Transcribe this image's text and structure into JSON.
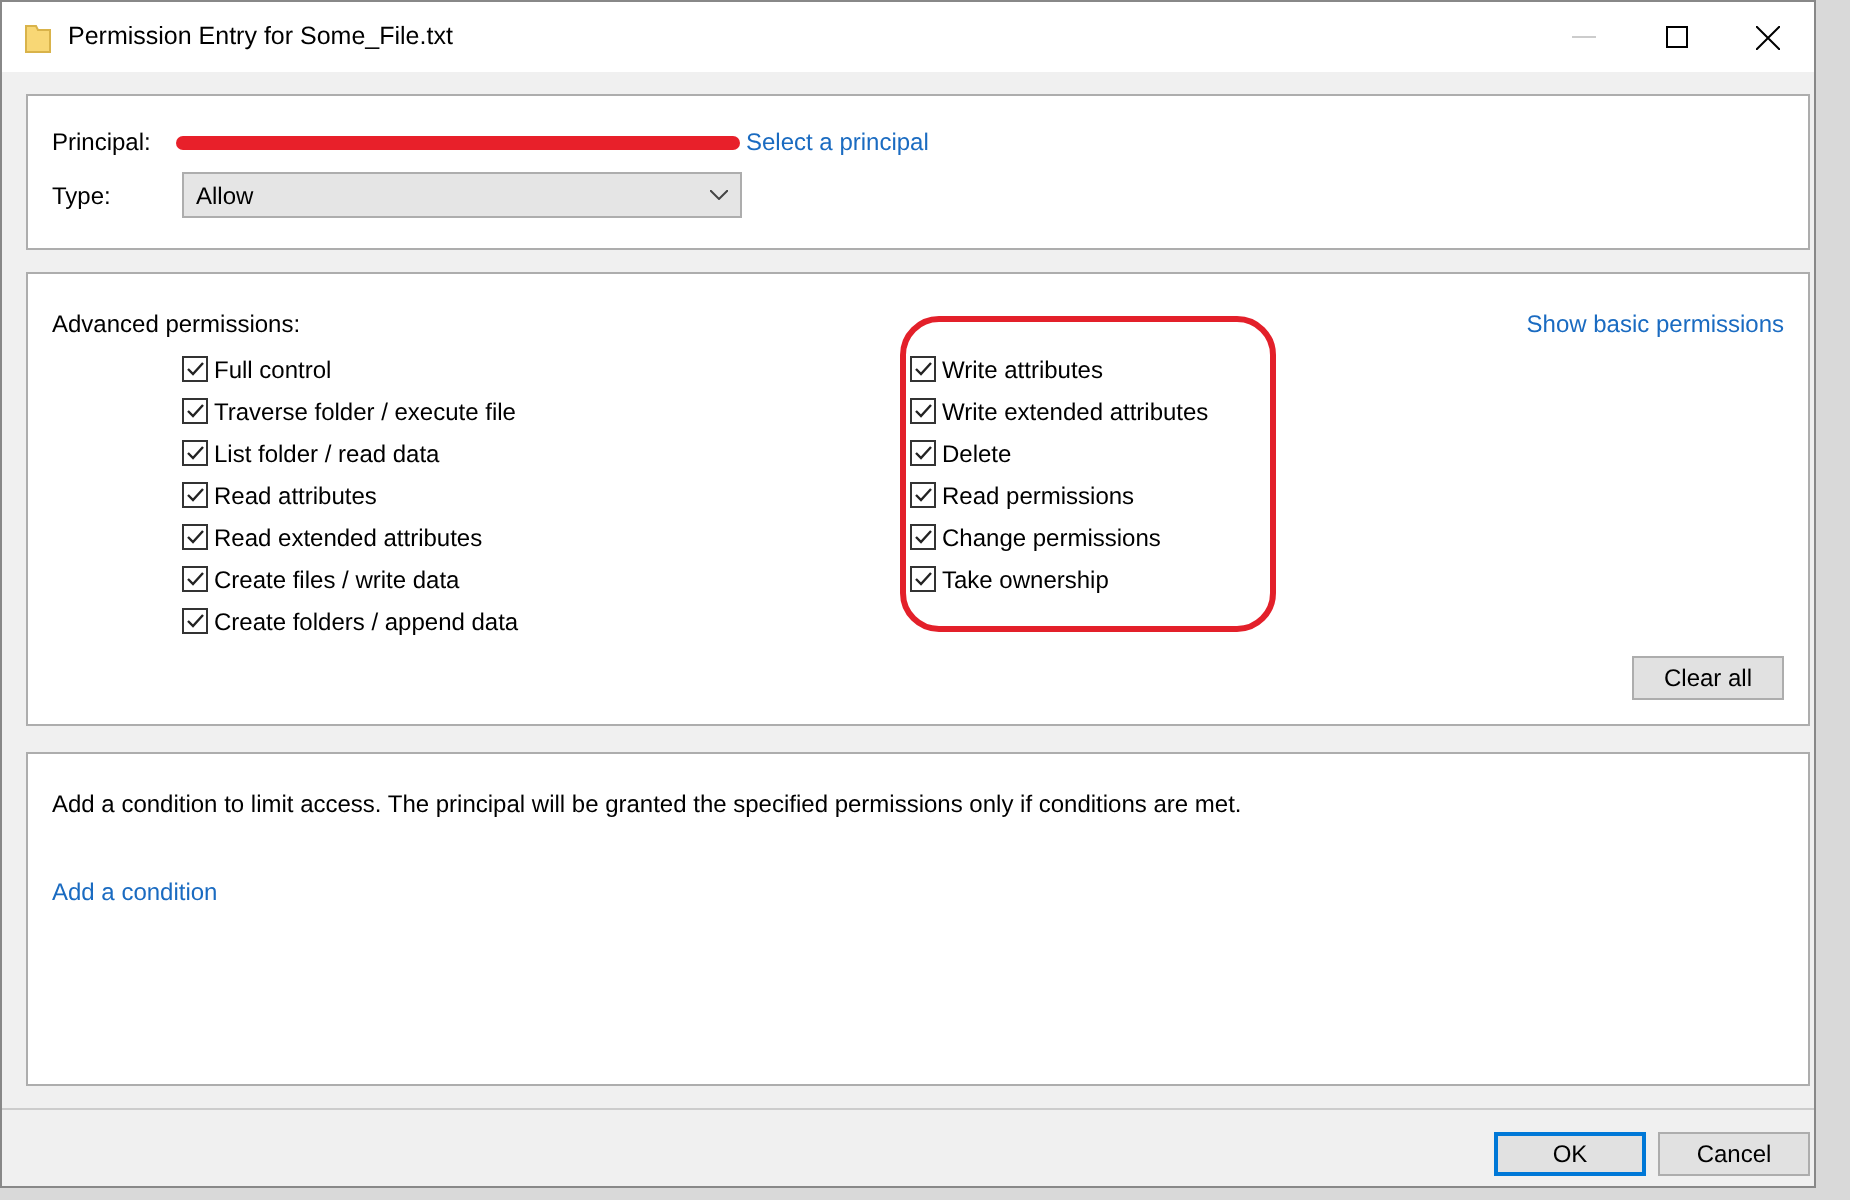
{
  "window": {
    "title": "Permission Entry for Some_File.txt",
    "minimize_disabled": true
  },
  "principal": {
    "label": "Principal:",
    "link": "Select a principal"
  },
  "type": {
    "label": "Type:",
    "value": "Allow"
  },
  "advanced": {
    "heading": "Advanced permissions:",
    "toggle_link": "Show basic permissions",
    "left_column": [
      {
        "label": "Full control",
        "checked": true
      },
      {
        "label": "Traverse folder / execute file",
        "checked": true
      },
      {
        "label": "List folder / read data",
        "checked": true
      },
      {
        "label": "Read attributes",
        "checked": true
      },
      {
        "label": "Read extended attributes",
        "checked": true
      },
      {
        "label": "Create files / write data",
        "checked": true
      },
      {
        "label": "Create folders / append data",
        "checked": true
      }
    ],
    "right_column": [
      {
        "label": "Write attributes",
        "checked": true
      },
      {
        "label": "Write extended attributes",
        "checked": true
      },
      {
        "label": "Delete",
        "checked": true
      },
      {
        "label": "Read permissions",
        "checked": true
      },
      {
        "label": "Change permissions",
        "checked": true
      },
      {
        "label": "Take ownership",
        "checked": true
      }
    ],
    "clear_button": "Clear all"
  },
  "condition": {
    "text": "Add a condition to limit access. The principal will be granted the specified permissions only if conditions are met.",
    "link": "Add a condition"
  },
  "buttons": [
    {
      "label": "OK",
      "default": true
    },
    {
      "label": "Cancel",
      "default": false
    }
  ]
}
